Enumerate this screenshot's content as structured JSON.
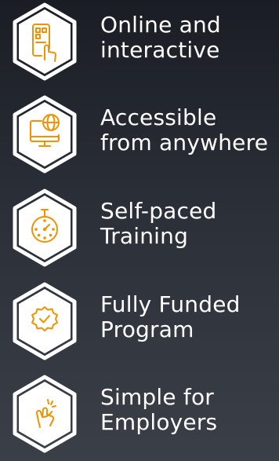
{
  "theme": {
    "accent": "#f39200",
    "hex_border": "#ffffff",
    "hex_fill": "#ffffff",
    "text": "#ffffff"
  },
  "features": [
    {
      "icon": "touch-screen-icon",
      "line1": "Online and",
      "line2": "interactive"
    },
    {
      "icon": "globe-monitor-icon",
      "line1": "Accessible",
      "line2": "from anywhere"
    },
    {
      "icon": "stopwatch-icon",
      "line1": "Self-paced",
      "line2": "Training"
    },
    {
      "icon": "verified-badge-icon",
      "line1": "Fully Funded",
      "line2": "Program"
    },
    {
      "icon": "snap-fingers-icon",
      "line1": "Simple for",
      "line2": "Employers"
    }
  ]
}
